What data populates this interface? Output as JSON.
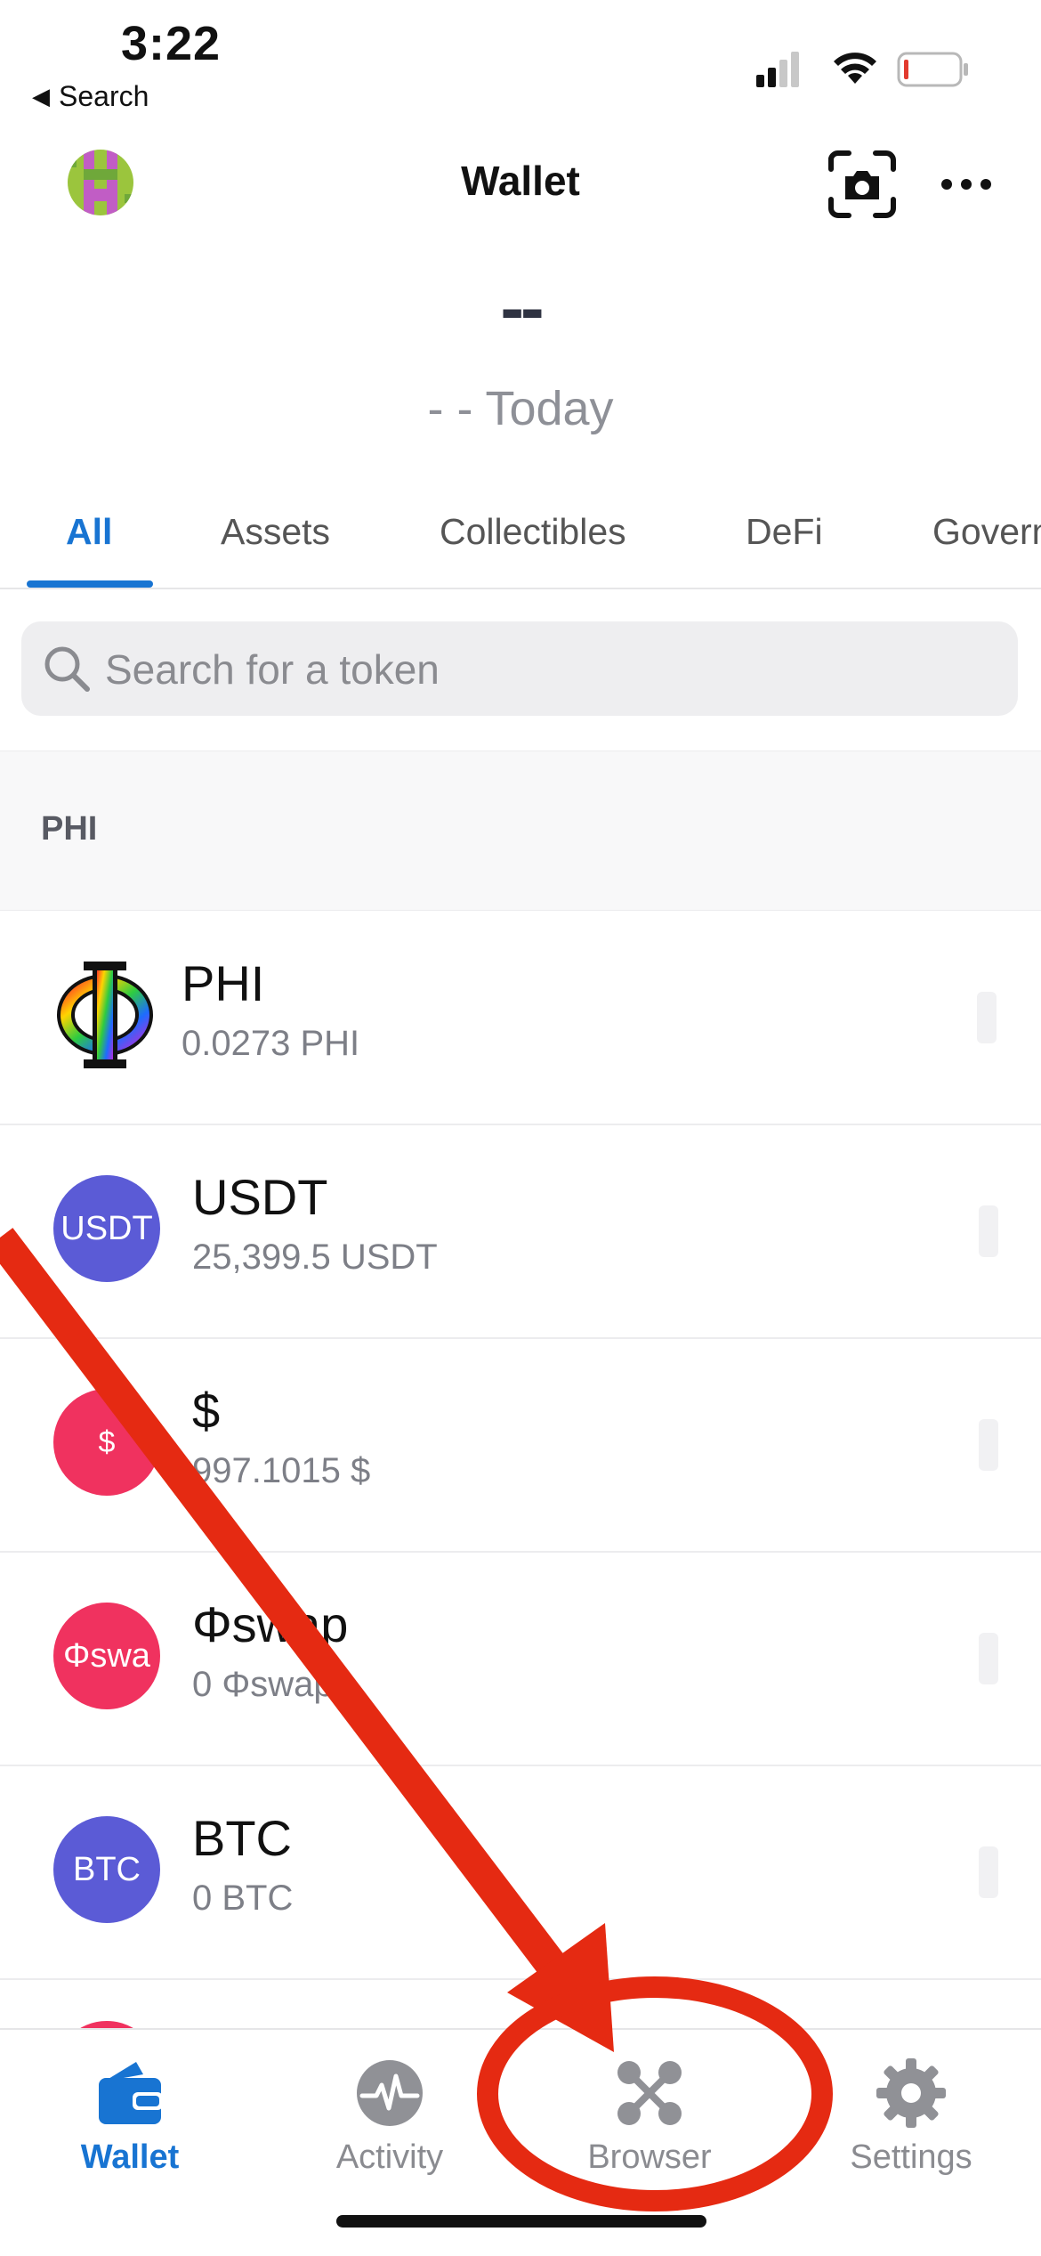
{
  "status_bar": {
    "time": "3:22",
    "back_label": "Search"
  },
  "header": {
    "title": "Wallet"
  },
  "balance": {
    "value": "--",
    "change": "- - Today"
  },
  "tabs": [
    {
      "label": "All",
      "active": true
    },
    {
      "label": "Assets"
    },
    {
      "label": "Collectibles"
    },
    {
      "label": "DeFi"
    },
    {
      "label": "Govern"
    }
  ],
  "search": {
    "placeholder": "Search for a token"
  },
  "section": {
    "label": "PHI"
  },
  "tokens": [
    {
      "name": "PHI",
      "balance": "0.0273 PHI",
      "icon_text": "",
      "icon_color": "#ffffff"
    },
    {
      "name": "USDT",
      "balance": "25,399.5 USDT",
      "icon_text": "USDT",
      "icon_color": "#5b5bd6"
    },
    {
      "name": "$",
      "balance": "997.1015 $",
      "icon_text": "$",
      "icon_color": "#f0325f"
    },
    {
      "name": "Φswap",
      "balance": "0 Φswap",
      "icon_text": "Φswa",
      "icon_color": "#f0325f"
    },
    {
      "name": "BTC",
      "balance": "0 BTC",
      "icon_text": "BTC",
      "icon_color": "#5b5bd6"
    }
  ],
  "tabbar": [
    {
      "label": "Wallet",
      "icon": "wallet-icon",
      "active": true
    },
    {
      "label": "Activity",
      "icon": "activity-icon"
    },
    {
      "label": "Browser",
      "icon": "browser-icon"
    },
    {
      "label": "Settings",
      "icon": "gear-icon"
    }
  ],
  "colors": {
    "accent": "#1874d2",
    "annotation": "#e52a12"
  }
}
